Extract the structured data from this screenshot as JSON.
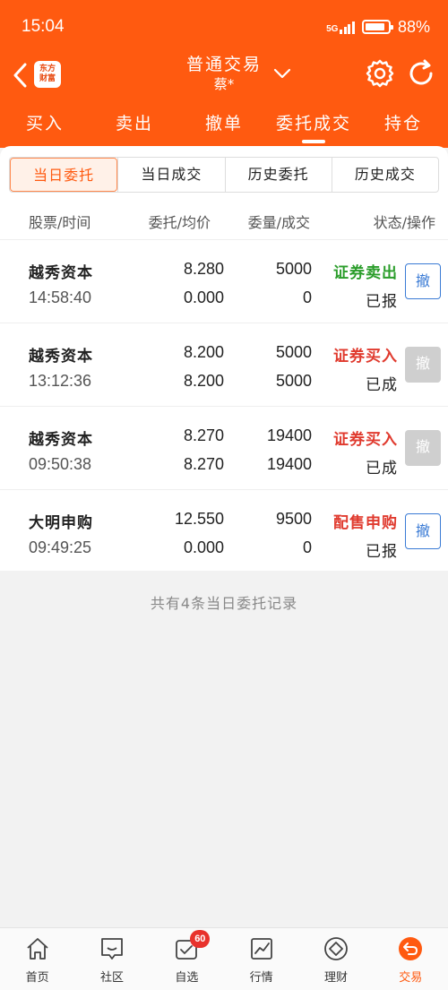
{
  "status_bar": {
    "time": "15:04",
    "network": "5G",
    "battery": "88%",
    "battery_level": 0.88
  },
  "header": {
    "logo_line1": "东方",
    "logo_line2": "财富",
    "title": "普通交易",
    "subtitle": "蔡*"
  },
  "tabs": [
    {
      "label": "买入"
    },
    {
      "label": "卖出"
    },
    {
      "label": "撤单"
    },
    {
      "label": "委托成交"
    },
    {
      "label": "持仓"
    }
  ],
  "segments": [
    {
      "label": "当日委托"
    },
    {
      "label": "当日成交"
    },
    {
      "label": "历史委托"
    },
    {
      "label": "历史成交"
    }
  ],
  "columns": {
    "c1": "股票/时间",
    "c2": "委托/均价",
    "c3": "委量/成交",
    "c4": "状态/操作"
  },
  "orders": [
    {
      "name": "越秀资本",
      "time": "14:58:40",
      "price": "8.280",
      "avg": "0.000",
      "qty": "5000",
      "filled": "0",
      "type": "证券卖出",
      "status": "已报",
      "cancel": "撤",
      "type_color": "#2a9d2a",
      "cancel_enabled": true
    },
    {
      "name": "越秀资本",
      "time": "13:12:36",
      "price": "8.200",
      "avg": "8.200",
      "qty": "5000",
      "filled": "5000",
      "type": "证券买入",
      "status": "已成",
      "cancel": "撤",
      "type_color": "#e03a2e",
      "cancel_enabled": false
    },
    {
      "name": "越秀资本",
      "time": "09:50:38",
      "price": "8.270",
      "avg": "8.270",
      "qty": "19400",
      "filled": "19400",
      "type": "证券买入",
      "status": "已成",
      "cancel": "撤",
      "type_color": "#e03a2e",
      "cancel_enabled": false
    },
    {
      "name": "大明申购",
      "time": "09:49:25",
      "price": "12.550",
      "avg": "0.000",
      "qty": "9500",
      "filled": "0",
      "type": "配售申购",
      "status": "已报",
      "cancel": "撤",
      "type_color": "#e03a2e",
      "cancel_enabled": true
    }
  ],
  "footer_note": "共有4条当日委托记录",
  "bottom_nav": [
    {
      "label": "首页",
      "icon": "home-icon"
    },
    {
      "label": "社区",
      "icon": "community-icon"
    },
    {
      "label": "自选",
      "icon": "watchlist-icon",
      "badge": "60"
    },
    {
      "label": "行情",
      "icon": "market-icon"
    },
    {
      "label": "理财",
      "icon": "wealth-icon"
    },
    {
      "label": "交易",
      "icon": "trade-icon"
    }
  ],
  "colors": {
    "brand": "#ff5a10",
    "sell": "#2a9d2a",
    "buy": "#e03a2e",
    "cancel_blue": "#3a7bd5"
  }
}
